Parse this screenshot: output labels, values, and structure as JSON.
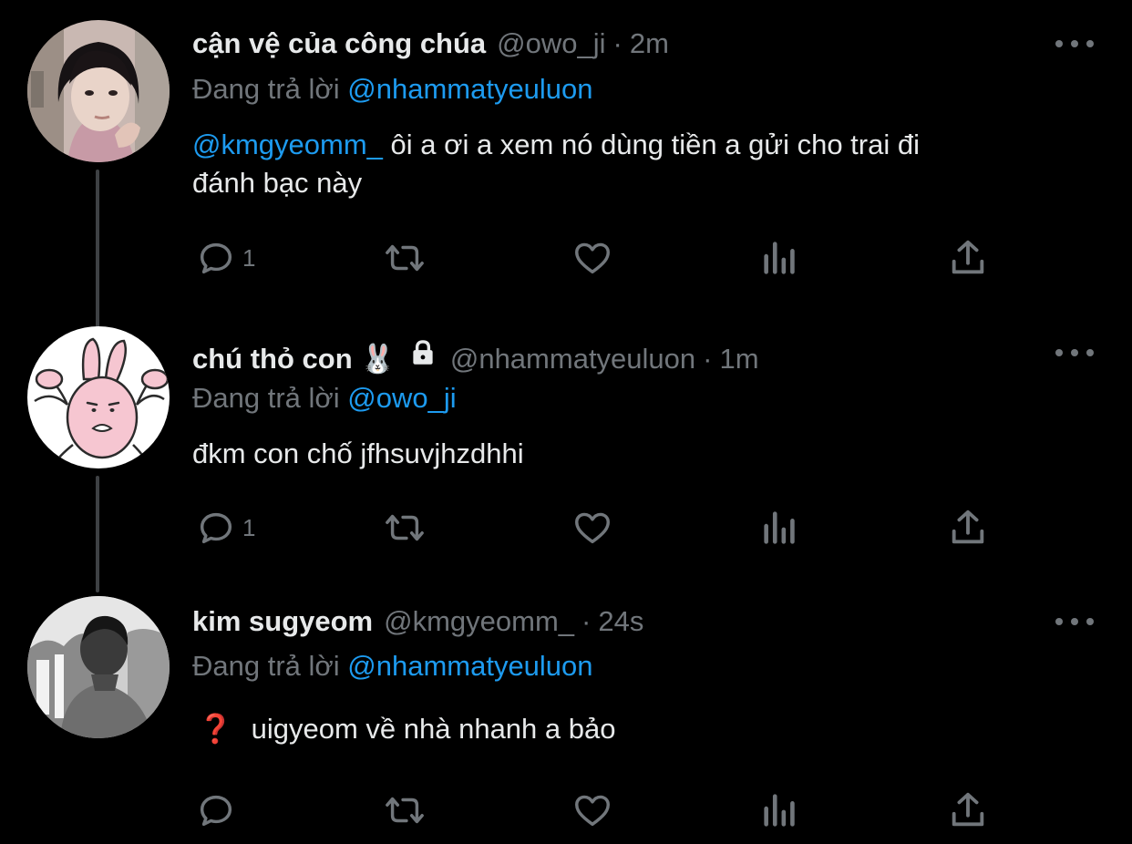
{
  "tweets": [
    {
      "display_name": "cận vệ của công chúa",
      "handle": "@owo_ji",
      "sep": "·",
      "time": "2m",
      "replying_prefix": "Đang trả lời",
      "replying_to": "@nhammatyeuluon",
      "mention": "@kmgyeomm_",
      "text_line1": " ôi a ơi a xem nó dùng tiền a gửi cho trai đi",
      "text_line2": "đánh bạc này",
      "reply_count": "1"
    },
    {
      "display_name": "chú thỏ con 🐰",
      "handle": "@nhammatyeuluon",
      "sep": "·",
      "time": "1m",
      "replying_prefix": "Đang trả lời",
      "replying_to": "@owo_ji",
      "text": "đkm con chố jfhsuvjhzdhhi",
      "reply_count": "1"
    },
    {
      "display_name": "kim sugyeom",
      "handle": "@kmgyeomm_",
      "sep": "·",
      "time": "24s",
      "replying_prefix": "Đang trả lời",
      "replying_to": "@nhammatyeuluon",
      "emoji": "❓",
      "text": "uigyeom về nhà nhanh a bảo",
      "reply_count": ""
    }
  ],
  "icons": [
    "reply-icon",
    "retweet-icon",
    "like-icon",
    "analytics-icon",
    "share-icon",
    "more-icon",
    "lock-icon"
  ],
  "colors": {
    "background": "#000000",
    "text": "#e7e9ea",
    "muted": "#71767b",
    "mention": "#1d9bf0"
  }
}
